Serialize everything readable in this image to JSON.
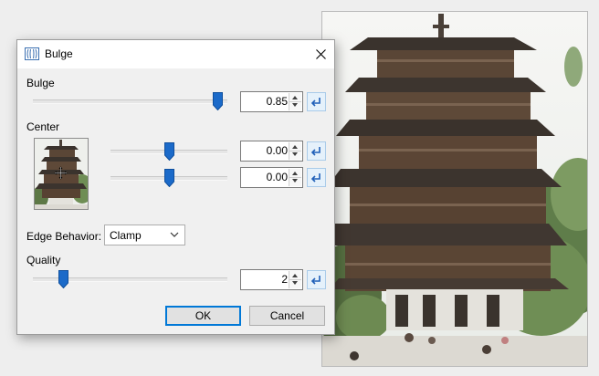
{
  "dialog": {
    "title": "Bulge",
    "close_icon": "close-icon",
    "title_icon": "bulge-effect-icon"
  },
  "bulge": {
    "label": "Bulge",
    "value": "0.85",
    "slider_fraction": 0.92
  },
  "center": {
    "label": "Center",
    "x_value": "0.00",
    "y_value": "0.00",
    "x_slider_fraction": 0.5,
    "y_slider_fraction": 0.5
  },
  "edge_behavior": {
    "label": "Edge Behavior:",
    "selected": "Clamp"
  },
  "quality": {
    "label": "Quality",
    "value": "2",
    "slider_fraction": 0.167
  },
  "buttons": {
    "ok": "OK",
    "cancel": "Cancel"
  },
  "icons": {
    "reset": "reset-arrow-icon",
    "move": "move-crosshair-icon",
    "dropdown": "chevron-down-icon"
  },
  "colors": {
    "accent": "#0078d7",
    "slider_thumb": "#1b6ac9"
  }
}
